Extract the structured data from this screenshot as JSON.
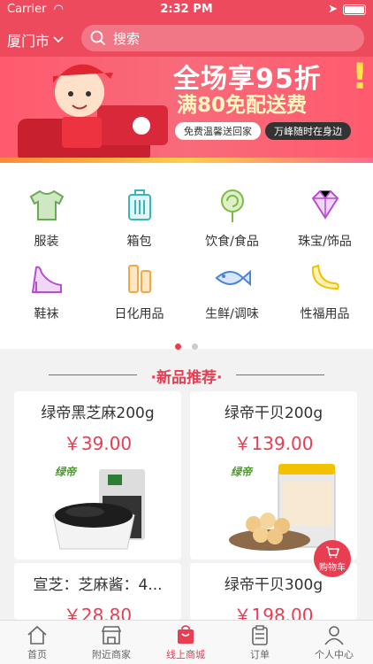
{
  "status": {
    "carrier": "Carrier",
    "time": "2:32 PM"
  },
  "header": {
    "city": "厦门市",
    "search_placeholder": "搜索"
  },
  "banner": {
    "title": "全场享95折",
    "subtitle": "满80免配送费",
    "tag1": "免费温馨送回家",
    "tag2": "万峰随时在身边"
  },
  "categories": [
    {
      "label": "服装",
      "icon": "tshirt-icon"
    },
    {
      "label": "箱包",
      "icon": "luggage-icon"
    },
    {
      "label": "饮食/食品",
      "icon": "lollipop-icon"
    },
    {
      "label": "珠宝/饰品",
      "icon": "diamond-icon"
    },
    {
      "label": "鞋袜",
      "icon": "high-heel-icon"
    },
    {
      "label": "日化用品",
      "icon": "toiletries-icon"
    },
    {
      "label": "生鲜/调味",
      "icon": "fish-icon"
    },
    {
      "label": "性福用品",
      "icon": "banana-icon"
    }
  ],
  "section": {
    "title": "·新品推荐·"
  },
  "products": [
    {
      "name": "绿帝黑芝麻200g",
      "price": "￥39.00",
      "brand": "绿帝"
    },
    {
      "name": "绿帝干贝200g",
      "price": "￥139.00",
      "brand": "绿帝"
    },
    {
      "name": "宣芝：芝麻酱：4...",
      "price": "￥28.80"
    },
    {
      "name": "绿帝干贝300g",
      "price": "￥198.00"
    }
  ],
  "cart_fab": {
    "label": "购物车"
  },
  "tabbar": [
    {
      "label": "首页"
    },
    {
      "label": "附近商家"
    },
    {
      "label": "线上商城"
    },
    {
      "label": "订单"
    },
    {
      "label": "个人中心"
    }
  ],
  "colors": {
    "accent": "#ee4a5e",
    "price": "#e93d52",
    "active_tab": "#e93d52"
  }
}
